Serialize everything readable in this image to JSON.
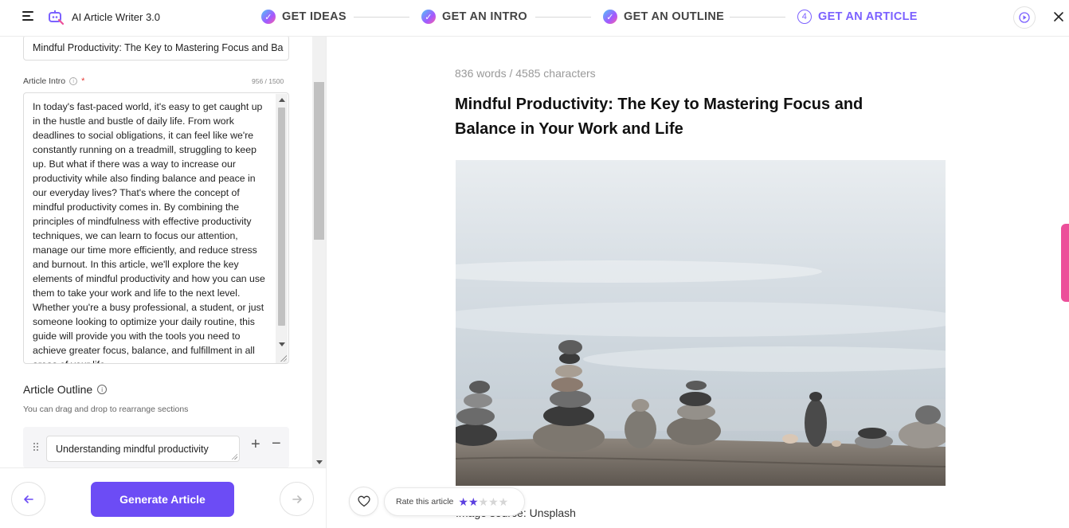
{
  "app": {
    "title": "AI Article Writer 3.0"
  },
  "steps": [
    {
      "label": "GET IDEAS",
      "state": "done"
    },
    {
      "label": "GET AN INTRO",
      "state": "done"
    },
    {
      "label": "GET AN OUTLINE",
      "state": "done"
    },
    {
      "label": "GET AN ARTICLE",
      "state": "active",
      "number": "4"
    }
  ],
  "left": {
    "title_value": "Mindful Productivity: The Key to Mastering Focus and Ba",
    "intro_label": "Article Intro",
    "intro_info": "i",
    "intro_required": "*",
    "intro_count": "956 / 1500",
    "intro_text": "In today's fast-paced world, it's easy to get caught up in the hustle and bustle of daily life. From work deadlines to social obligations, it can feel like we're constantly running on a treadmill, struggling to keep up. But what if there was a way to increase our productivity while also finding balance and peace in our everyday lives? That's where the concept of mindful productivity comes in. By combining the principles of mindfulness with effective productivity techniques, we can learn to focus our attention, manage our time more efficiently, and reduce stress and burnout. In this article, we'll explore the key elements of mindful productivity and how you can use them to take your work and life to the next level. Whether you're a busy professional, a student, or just someone looking to optimize your daily routine, this guide will provide you with the tools you need to achieve greater focus, balance, and fulfillment in all areas of your life.",
    "outline_title": "Article Outline",
    "outline_info": "i",
    "outline_hint": "You can drag and drop to rearrange sections",
    "outline_items": [
      "Understanding mindful productivity"
    ],
    "plus": "+",
    "minus": "−"
  },
  "footer": {
    "generate_label": "Generate Article"
  },
  "right": {
    "counts": "836 words / 4585 characters",
    "article_title": "Mindful Productivity: The Key to Mastering Focus and Balance in Your Work and Life",
    "image_credit": "Image source: Unsplash",
    "rate_label": "Rate this article",
    "rating": 2,
    "rating_max": 5
  },
  "colors": {
    "accent": "#6c4cf5",
    "step_active": "#7b61ff",
    "star_filled": "#5b3fe0",
    "star_empty": "#d6d6d6",
    "side_tab": "#ec4f9a"
  },
  "icons": {
    "menu": "hamburger-icon",
    "logo": "robot-pen-icon",
    "play": "play-circle-icon",
    "close": "close-icon",
    "back": "arrow-left-icon",
    "next": "arrow-right-icon",
    "like": "heart-icon",
    "drag": "drag-handle-icon"
  }
}
